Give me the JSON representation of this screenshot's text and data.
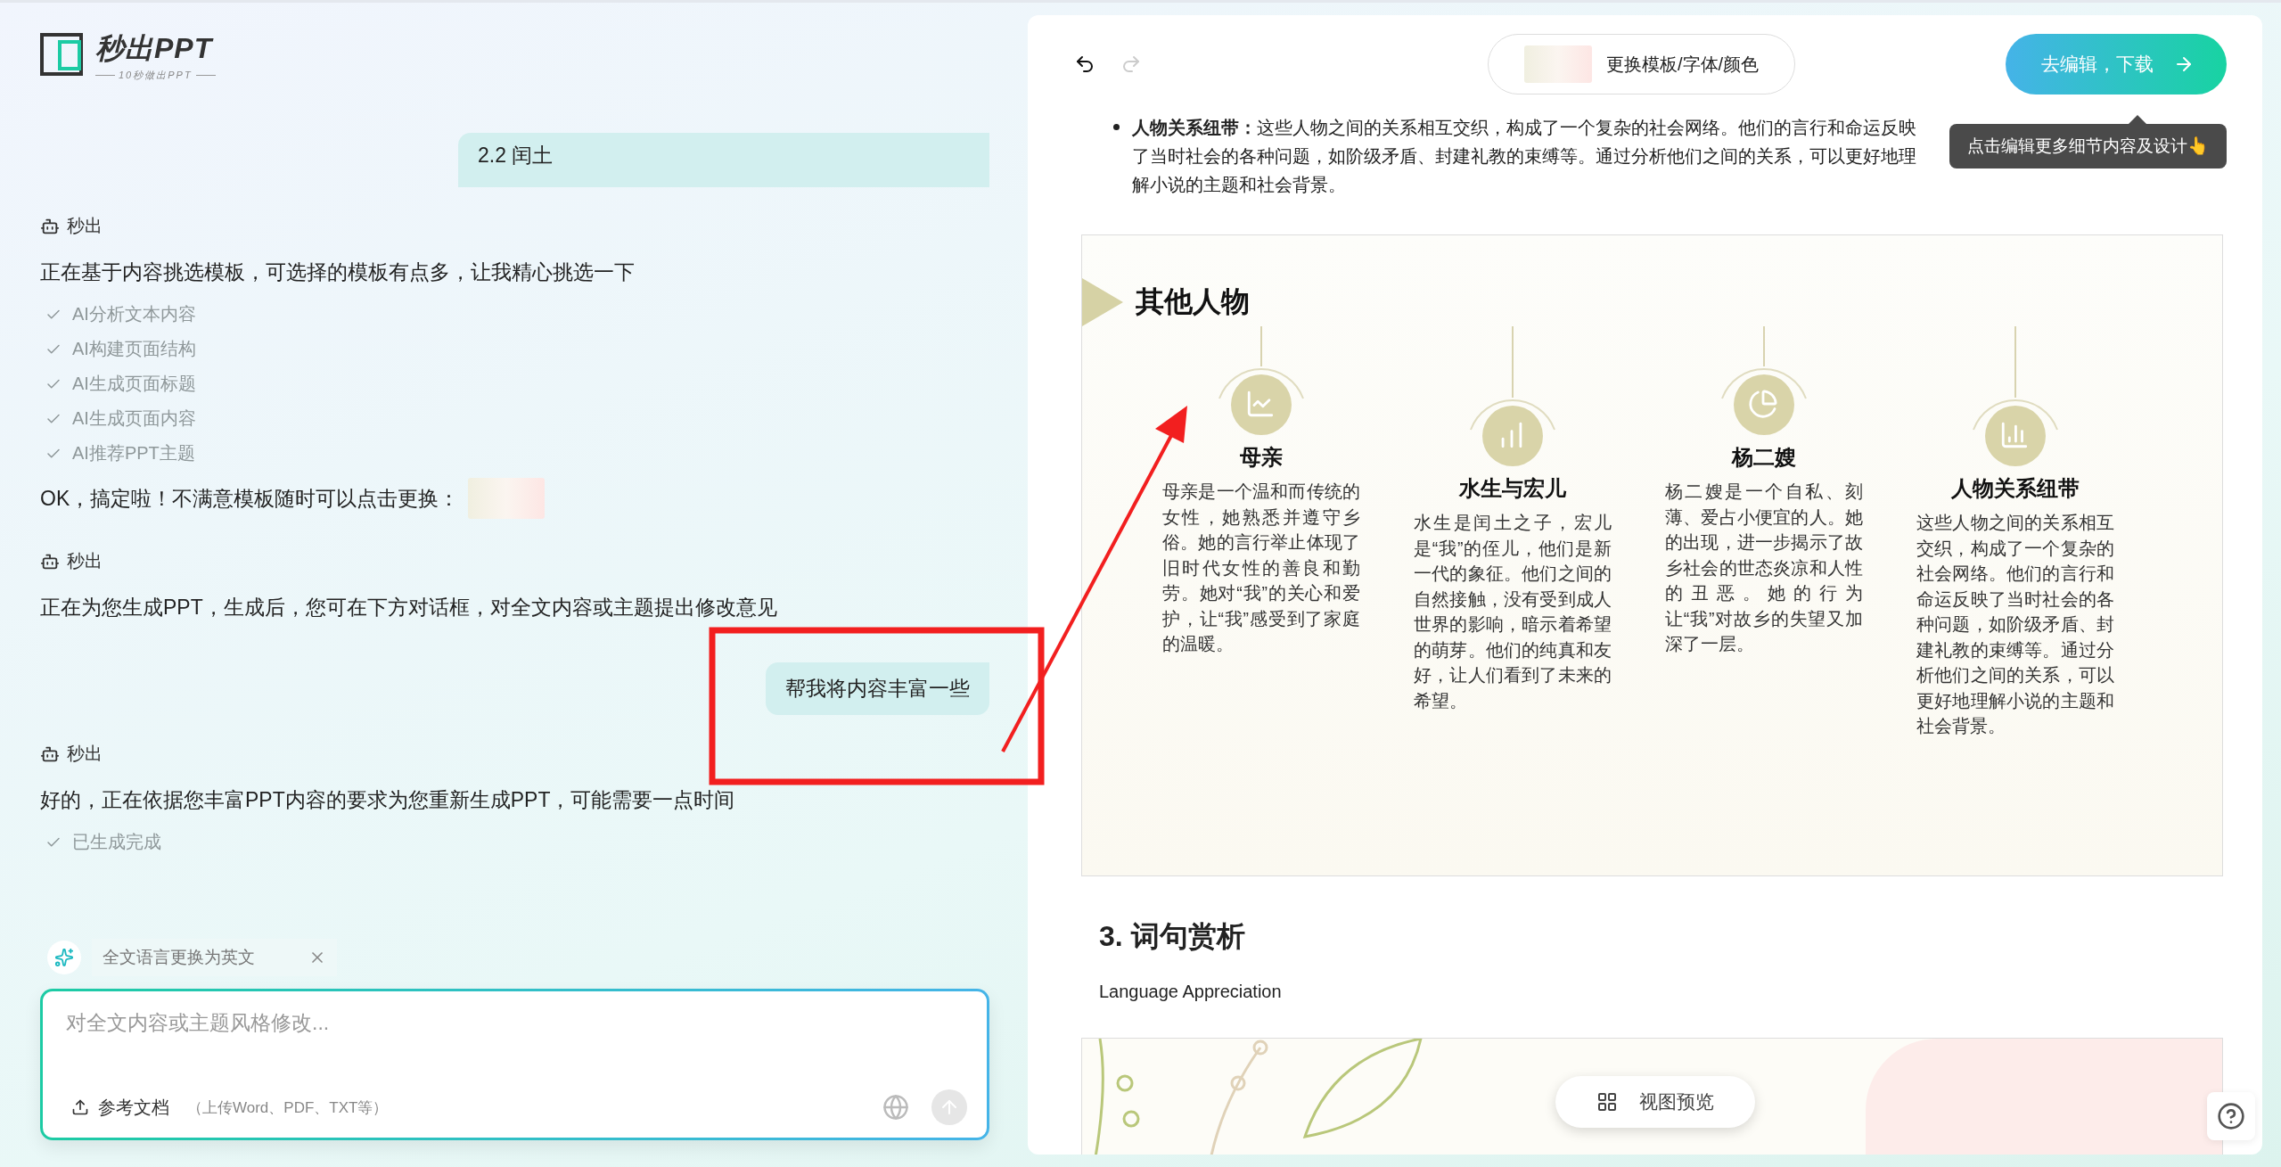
{
  "logo": {
    "name": "秒出PPT",
    "tagline": "10秒做出PPT"
  },
  "chat": {
    "messages": [
      {
        "kind": "user",
        "text": "2.2 闰土"
      },
      {
        "kind": "bot",
        "sender": "秒出",
        "blocks": [
          {
            "kind": "text",
            "text": "正在基于内容挑选模板，可选择的模板有点多，让我精心挑选一下"
          },
          {
            "kind": "step",
            "label": "AI分析文本内容",
            "done": true
          },
          {
            "kind": "step",
            "label": "AI构建页面结构",
            "done": true
          },
          {
            "kind": "step",
            "label": "AI生成页面标题",
            "done": true
          },
          {
            "kind": "step",
            "label": "AI生成页面内容",
            "done": true
          },
          {
            "kind": "step",
            "label": "AI推荐PPT主题",
            "done": true
          },
          {
            "kind": "thumb-text",
            "text": "OK，搞定啦！不满意模板随时可以点击更换："
          }
        ]
      },
      {
        "kind": "bot",
        "sender": "秒出",
        "blocks": [
          {
            "kind": "text",
            "text": "正在为您生成PPT，生成后，您可在下方对话框，对全文内容或主题提出修改意见"
          }
        ]
      },
      {
        "kind": "user",
        "text": "帮我将内容丰富一些"
      },
      {
        "kind": "bot",
        "sender": "秒出",
        "blocks": [
          {
            "kind": "text",
            "text": "好的，正在依据您丰富PPT内容的要求为您重新生成PPT，可能需要一点时间"
          },
          {
            "kind": "step",
            "label": "已生成完成",
            "done": true
          }
        ]
      }
    ]
  },
  "suggestion": {
    "text": "全文语言更换为英文"
  },
  "composer": {
    "placeholder": "对全文内容或主题风格修改...",
    "upload_label": "参考文档",
    "upload_hint": "（上传Word、PDF、TXT等）"
  },
  "toolbar": {
    "undo": {
      "disabled": false
    },
    "redo": {
      "disabled": true
    },
    "template_button": "更换模板/字体/颜色",
    "edit_button": "去编辑，下载",
    "tooltip": "点击编辑更多细节内容及设计👆"
  },
  "document": {
    "bullet": "**人物关系纽带：**这些人物之间的关系相互交织，构成了一个复杂的社会网络。他们的言行和命运反映了当时社会的各种问题，如阶级矛盾、封建礼教的束缚等。通过分析他们之间的关系，可以更好地理解小说的主题和社会背景。",
    "slide": {
      "title": "其他人物",
      "characters": [
        {
          "name": "母亲",
          "text": "母亲是一个温和而传统的女性，她熟悉并遵守乡俗。她的言行举止体现了旧时代女性的善良和勤劳。她对“我”的关心和爱护，让“我”感受到了家庭的温暖。"
        },
        {
          "name": "水生与宏儿",
          "text": "水生是闰土之子，宏儿是“我”的侄儿，他们是新一代的象征。他们之间的自然接触，没有受到成人世界的影响，暗示着希望的萌芽。他们的纯真和友好，让人们看到了未来的希望。"
        },
        {
          "name": "杨二嫂",
          "text": "杨二嫂是一个自私、刻薄、爱占小便宜的人。她的出现，进一步揭示了故乡社会的世态炎凉和人性的丑恶。她的行为让“我”对故乡的失望又加深了一层。"
        },
        {
          "name": "人物关系纽带",
          "text": "这些人物之间的关系相互交织，构成了一个复杂的社会网络。他们的言行和命运反映了当时社会的各种问题，如阶级矛盾、封建礼教的束缚等。通过分析他们之间的关系，可以更好地理解小说的主题和社会背景。"
        }
      ]
    },
    "section_heading": "3. 词句赏析",
    "section_subtitle": "Language Appreciation"
  },
  "view_button": "视图预览"
}
